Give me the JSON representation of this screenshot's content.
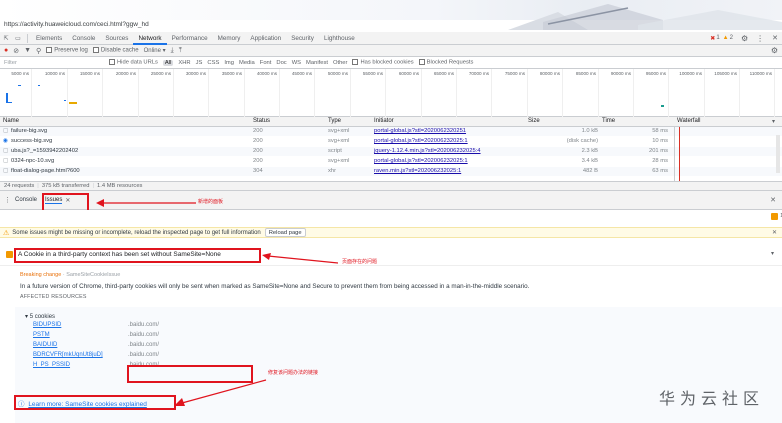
{
  "browser": {
    "url": "https://activity.huaweicloud.com/ceci.html?ggw_hd"
  },
  "devtools": {
    "tabs": [
      "Elements",
      "Console",
      "Sources",
      "Network",
      "Performance",
      "Memory",
      "Application",
      "Security",
      "Lighthouse"
    ],
    "active_tab": "Network",
    "error_count": "1",
    "warning_count": "2",
    "toolbar": {
      "preserve_log": "Preserve log",
      "disable_cache": "Disable cache",
      "online": "Online"
    },
    "filter": {
      "placeholder": "Filter",
      "hide_data_urls": "Hide data URLs",
      "types": [
        "All",
        "XHR",
        "JS",
        "CSS",
        "Img",
        "Media",
        "Font",
        "Doc",
        "WS",
        "Manifest",
        "Other"
      ],
      "has_blocked_cookies": "Has blocked cookies",
      "blocked_requests": "Blocked Requests"
    },
    "timeline_ticks": [
      "5000 ms",
      "10000 ms",
      "15000 ms",
      "20000 ms",
      "25000 ms",
      "30000 ms",
      "35000 ms",
      "40000 ms",
      "45000 ms",
      "50000 ms",
      "55000 ms",
      "60000 ms",
      "65000 ms",
      "70000 ms",
      "75000 ms",
      "80000 ms",
      "85000 ms",
      "90000 ms",
      "95000 ms",
      "100000 ms",
      "105000 ms",
      "110000 ms"
    ],
    "table": {
      "headers": [
        "Name",
        "Status",
        "Type",
        "Initiator",
        "Size",
        "Time",
        "Waterfall"
      ],
      "rows": [
        {
          "name": "failure-big.svg",
          "status": "200",
          "type": "svg+xml",
          "initiator": "portal-global.js?stl=2020062320251",
          "size": "1.0 kB",
          "time": "58 ms"
        },
        {
          "name": "success-big.svg",
          "status": "200",
          "type": "svg+xml",
          "initiator": "portal-global.js?stl=202006232025:1",
          "size": "(disk cache)",
          "time": "10 ms"
        },
        {
          "name": "uba.js?_=1593942202402",
          "status": "200",
          "type": "script",
          "initiator": "jquery-1.12.4.min.js?stl=202006232025:4",
          "size": "2.3 kB",
          "time": "201 ms"
        },
        {
          "name": "0324-npc-10.svg",
          "status": "200",
          "type": "svg+xml",
          "initiator": "portal-global.js?stl=202006232025:1",
          "size": "3.4 kB",
          "time": "28 ms"
        },
        {
          "name": "float-dialog-page.html?600",
          "status": "304",
          "type": "xhr",
          "initiator": "raven.min.js?stl=202006232025:1",
          "size": "482 B",
          "time": "63 ms"
        }
      ]
    },
    "status_bar": {
      "requests": "24 requests",
      "transferred": "375 kB transferred",
      "resources": "1.4 MB resources"
    },
    "drawer": {
      "tabs": [
        "Console",
        "Issues"
      ],
      "active_tab": "Issues",
      "annotation": "新增的面板"
    },
    "issues": {
      "warning_bar_text": "Some issues might be missing or incomplete, reload the inspected page to get full information",
      "reload_button": "Reload page",
      "issue_count": "1",
      "title": "A Cookie in a third-party context has been set without SameSite=None",
      "title_annotation": "页面存在的问题",
      "category": "Breaking change",
      "category_suffix": "SameSiteCookieIssue",
      "description": "In a future version of Chrome, third-party cookies will only be sent when marked as SameSite=None and Secure to prevent them from being accessed in a man-in-the-middle scenario.",
      "affected_resources_label": "AFFECTED RESOURCES",
      "cookies_label": "5 cookies",
      "cookies": [
        {
          "name": "BIDUPSID",
          "domain": ".baidu.com/"
        },
        {
          "name": "PSTM",
          "domain": ".baidu.com/"
        },
        {
          "name": "BAIDUID",
          "domain": ".baidu.com/"
        },
        {
          "name": "BDRCVFR[mkUqnUt8juD]",
          "domain": ".baidu.com/"
        },
        {
          "name": "H_PS_PSSID",
          "domain": ".baidu.com/"
        }
      ],
      "fix_annotation": "修复该问题办法的链接",
      "learn_more": "Learn more: SameSite cookies explained"
    }
  },
  "watermark": "华为云社区",
  "colors": {
    "accent": "#1a73e8",
    "annotation_red": "#e0141e",
    "issue_icon": "#f29900",
    "error_red": "#d93025"
  }
}
